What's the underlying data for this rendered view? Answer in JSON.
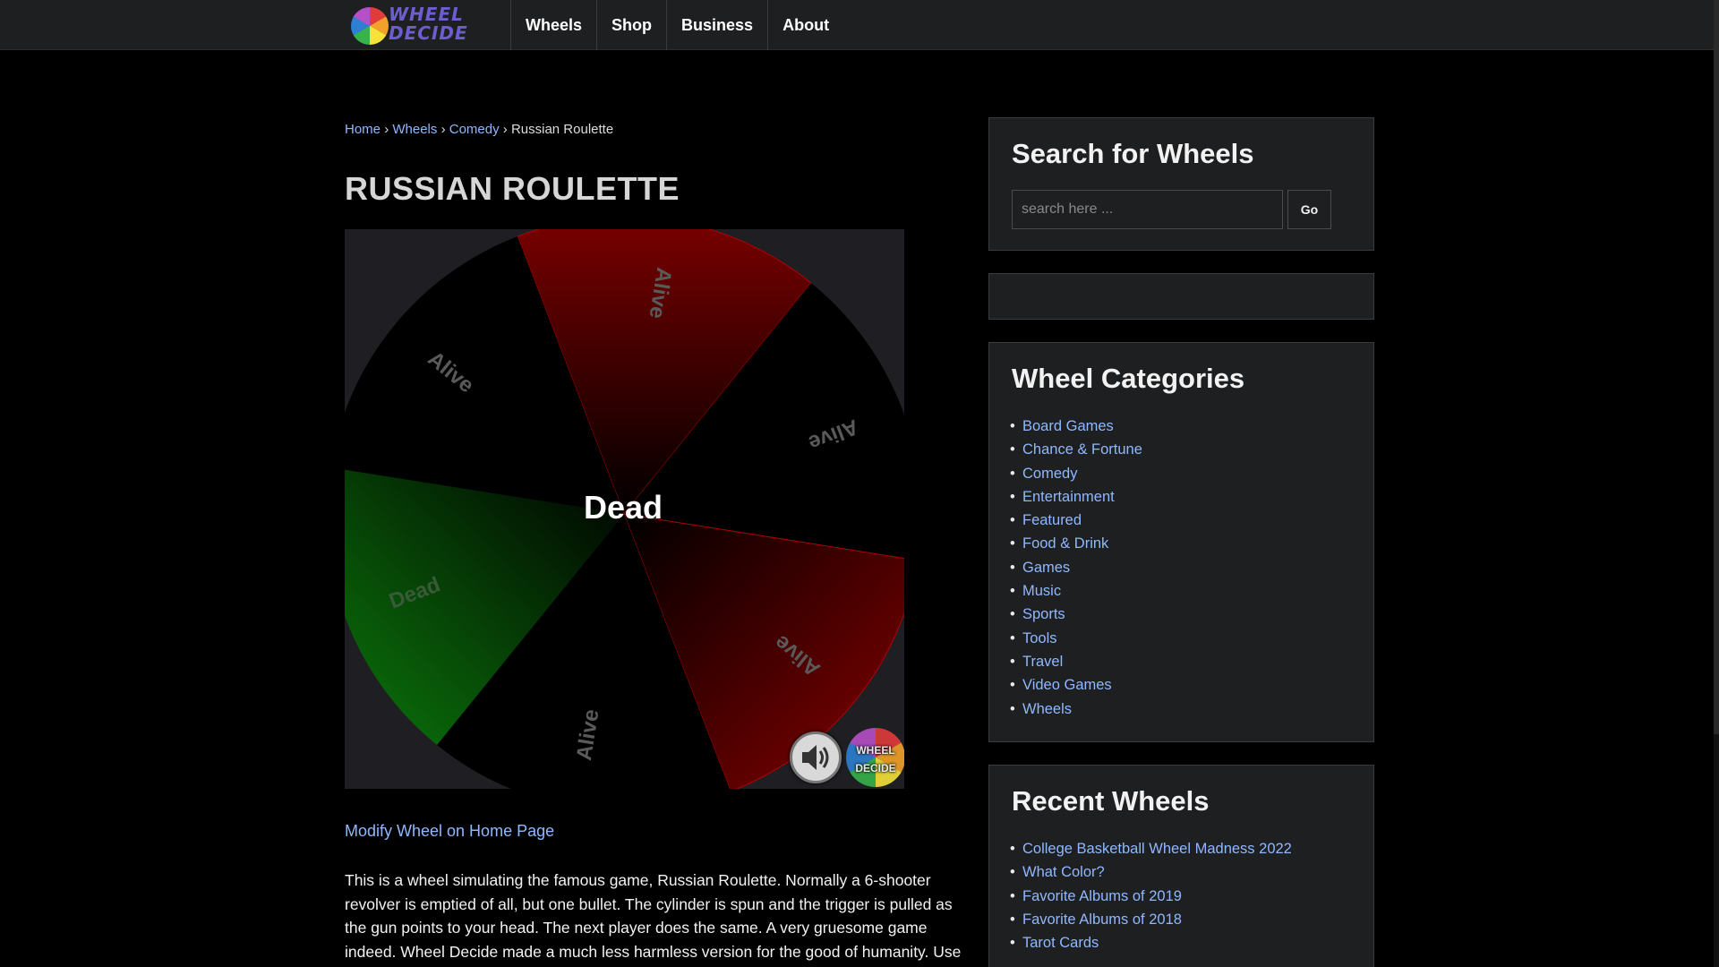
{
  "header": {
    "logo_alt": "Wheel Decide",
    "logo_lines": [
      "WHEEL",
      "DECIDE"
    ],
    "nav": [
      "Wheels",
      "Shop",
      "Business",
      "About"
    ]
  },
  "breadcrumb": {
    "home": "Home",
    "wheels": "Wheels",
    "category": "Comedy",
    "current": "Russian Roulette",
    "separator": "›"
  },
  "page_title": "RUSSIAN ROULETTE",
  "wheel": {
    "result_text": "Dead",
    "segments": [
      {
        "label": "Alive",
        "color": "#7a0000"
      },
      {
        "label": "Alive",
        "color": "#000000"
      },
      {
        "label": "Alive",
        "color": "#8a0000"
      },
      {
        "label": "Alive",
        "color": "#000000"
      },
      {
        "label": "Dead",
        "color": "#0b7a0b"
      },
      {
        "label": "Alive",
        "color": "#000000"
      }
    ],
    "sound_icon": "speaker-icon",
    "badge_lines": [
      "WHEEL",
      "DECIDE"
    ]
  },
  "modify_link": "Modify Wheel on Home Page",
  "description": "This is a wheel simulating the famous game, Russian Roulette. Normally a 6-shooter revolver is emptied of all, but one bullet. The cylinder is spun and the trigger is pulled as the gun points to your head. The next player does the same. A very gruesome game indeed. Wheel Decide made a much less harmless version for the good of humanity. Use",
  "sidebar": {
    "search": {
      "title": "Search for Wheels",
      "placeholder": "search here ...",
      "button": "Go"
    },
    "categories": {
      "title": "Wheel Categories",
      "items": [
        "Board Games",
        "Chance & Fortune",
        "Comedy",
        "Entertainment",
        "Featured",
        "Food & Drink",
        "Games",
        "Music",
        "Sports",
        "Tools",
        "Travel",
        "Video Games",
        "Wheels"
      ]
    },
    "recent": {
      "title": "Recent Wheels",
      "items": [
        "College Basketball Wheel Madness 2022",
        "What Color?",
        "Favorite Albums of 2019",
        "Favorite Albums of 2018",
        "Tarot Cards"
      ]
    }
  }
}
